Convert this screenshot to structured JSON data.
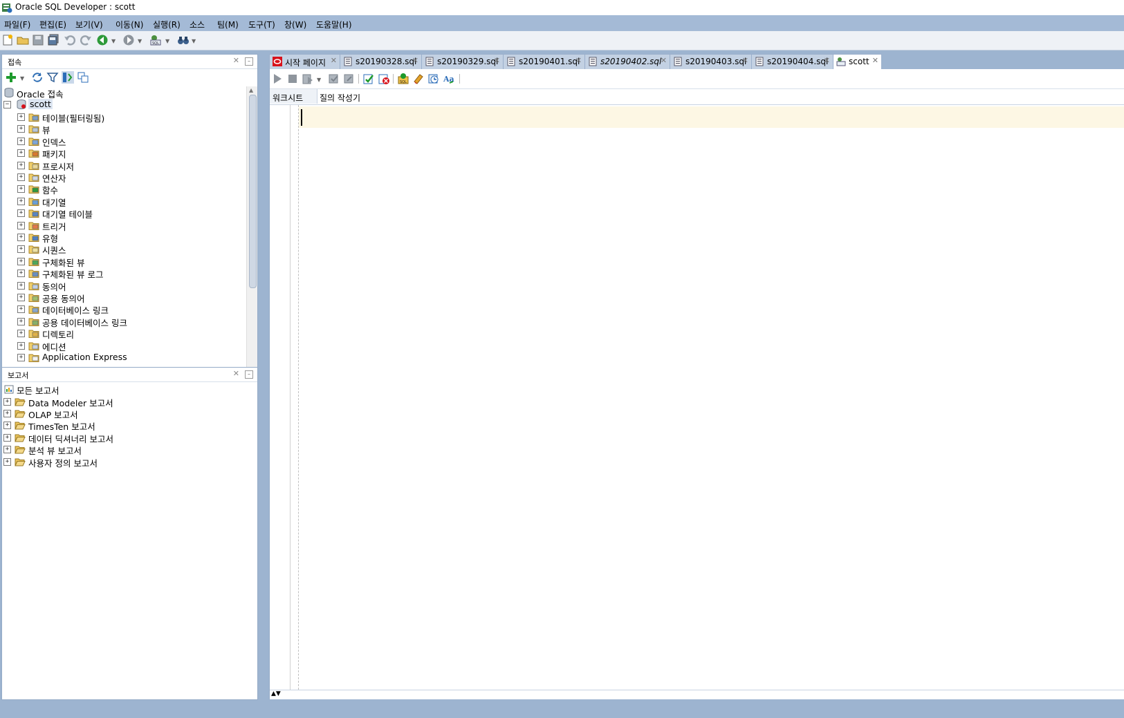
{
  "window": {
    "title": "Oracle SQL Developer : scott"
  },
  "menu": [
    "파일(F)",
    "편집(E)",
    "보기(V)",
    "이동(N)",
    "실행(R)",
    "소스",
    "팀(M)",
    "도구(T)",
    "창(W)",
    "도움말(H)"
  ],
  "connections_panel": {
    "title": "접속",
    "root": "Oracle 접속",
    "connection": "scott",
    "items": [
      "테이블(필터링됨)",
      "뷰",
      "인덱스",
      "패키지",
      "프로시저",
      "연산자",
      "함수",
      "대기열",
      "대기열 테이블",
      "트리거",
      "유형",
      "시퀀스",
      "구체화된 뷰",
      "구체화된 뷰 로그",
      "동의어",
      "공용 동의어",
      "데이터베이스 링크",
      "공용 데이터베이스 링크",
      "디렉토리",
      "에디션",
      "Application Express"
    ]
  },
  "reports_panel": {
    "title": "보고서",
    "root": "모든 보고서",
    "items": [
      "Data Modeler 보고서",
      "OLAP 보고서",
      "TimesTen 보고서",
      "데이터 딕셔너리 보고서",
      "분석 뷰 보고서",
      "사용자 정의 보고서"
    ]
  },
  "editor_tabs": [
    {
      "label": "시작 페이지",
      "icon": "oracle-start-icon",
      "active": false,
      "italic": false
    },
    {
      "label": "s20190328.sql",
      "icon": "sql-file-icon",
      "active": false,
      "italic": false
    },
    {
      "label": "s20190329.sql",
      "icon": "sql-file-icon",
      "active": false,
      "italic": false
    },
    {
      "label": "s20190401.sql",
      "icon": "sql-file-icon",
      "active": false,
      "italic": false
    },
    {
      "label": "s20190402.sql",
      "icon": "sql-file-icon",
      "active": false,
      "italic": true
    },
    {
      "label": "s20190403.sql",
      "icon": "sql-file-icon",
      "active": false,
      "italic": false
    },
    {
      "label": "s20190404.sql",
      "icon": "sql-file-icon",
      "active": false,
      "italic": false
    },
    {
      "label": "scott",
      "icon": "sql-worksheet-icon",
      "active": true,
      "italic": false
    }
  ],
  "editor": {
    "subtabs": [
      "워크시트",
      "질의 작성기"
    ],
    "active_subtab": "워크시트",
    "content": ""
  },
  "colors": {
    "frame": "#9db4d0",
    "menubar": "#a4bad6",
    "tab_inactive": "#c3d1e3",
    "current_line": "#fdf7e4",
    "oracle_red": "#d8121b"
  }
}
